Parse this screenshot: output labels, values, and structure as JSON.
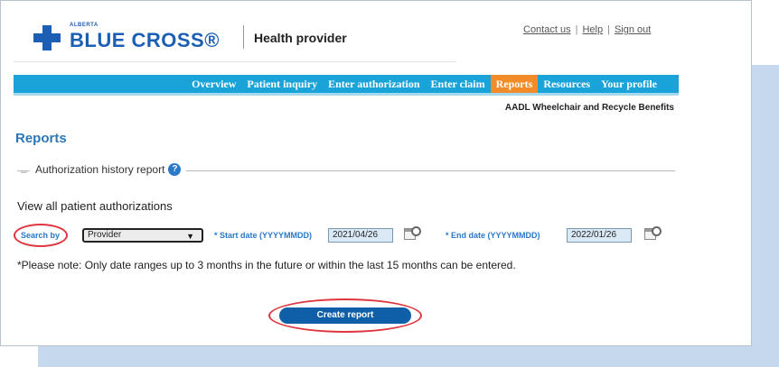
{
  "header": {
    "logo_small": "ALBERTA",
    "logo_text": "BLUE CROSS®",
    "subtitle": "Health provider",
    "links": [
      "Contact us",
      "Help",
      "Sign out"
    ]
  },
  "nav": {
    "items": [
      "Overview",
      "Patient inquiry",
      "Enter authorization",
      "Enter claim",
      "Reports",
      "Resources",
      "Your profile"
    ],
    "active": "Reports"
  },
  "subheading": "AADL Wheelchair and Recycle Benefits",
  "page_title": "Reports",
  "section": {
    "legend": "Authorization history report",
    "help_icon": "?",
    "description": "View all patient authorizations"
  },
  "form": {
    "search_by_label": "Search by",
    "search_by_value": "Provider",
    "start_label": "* Start date (YYYYMMDD)",
    "start_value": "2021/04/26",
    "end_label": "* End date (YYYYMMDD)",
    "end_value": "2022/01/26"
  },
  "note": "*Please note: Only date ranges up to 3 months in the future or within the last 15 months can be entered.",
  "button_label": "Create report",
  "colors": {
    "brand_blue": "#1b5fb4",
    "nav_bg": "#1aa3d8",
    "nav_active": "#f28c28",
    "highlight": "#e0343f",
    "button": "#0f5fa8"
  }
}
